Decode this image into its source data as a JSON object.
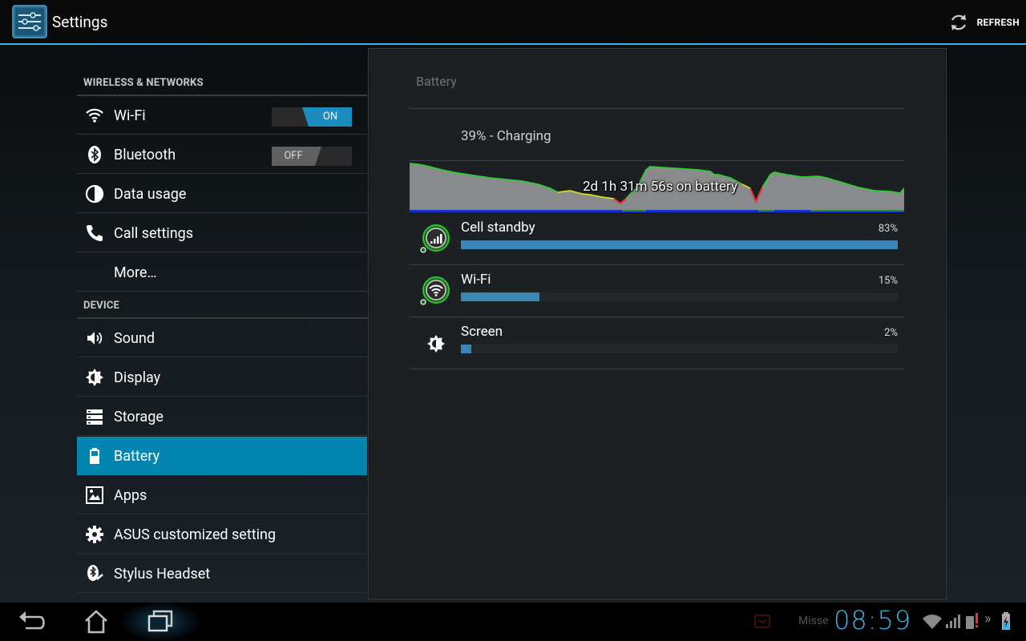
{
  "action_bar": {
    "title": "Settings",
    "refresh_label": "REFRESH"
  },
  "sidebar": {
    "sections": [
      {
        "header": "WIRELESS & NETWORKS"
      },
      {
        "header": "DEVICE"
      }
    ],
    "items": [
      {
        "label": "Wi-Fi",
        "icon": "wifi-icon",
        "toggle": "ON"
      },
      {
        "label": "Bluetooth",
        "icon": "bluetooth-icon",
        "toggle": "OFF"
      },
      {
        "label": "Data usage",
        "icon": "data-usage-icon"
      },
      {
        "label": "Call settings",
        "icon": "phone-icon"
      },
      {
        "label": "More…"
      },
      {
        "label": "Sound",
        "icon": "speaker-icon"
      },
      {
        "label": "Display",
        "icon": "brightness-icon"
      },
      {
        "label": "Storage",
        "icon": "storage-icon"
      },
      {
        "label": "Battery",
        "icon": "battery-icon",
        "selected": true
      },
      {
        "label": "Apps",
        "icon": "apps-icon"
      },
      {
        "label": "ASUS customized setting",
        "icon": "gear-icon"
      },
      {
        "label": "Stylus Headset",
        "icon": "stylus-headset-icon"
      }
    ]
  },
  "battery": {
    "title": "Battery",
    "status": "39% - Charging",
    "history_label": "2d 1h 31m 56s on battery",
    "usage": [
      {
        "name": "Cell standby",
        "percent_label": "83%",
        "percent": 83,
        "icon": "cell-signal-icon"
      },
      {
        "name": "Wi-Fi",
        "percent_label": "15%",
        "percent": 15,
        "icon": "wifi-icon"
      },
      {
        "name": "Screen",
        "percent_label": "2%",
        "percent": 2,
        "icon": "brightness-icon"
      }
    ]
  },
  "status_bar": {
    "notification_text": "Misse",
    "clock": "08:59"
  },
  "colors": {
    "accent": "#33b5e5",
    "selected_item": "#0385b1",
    "usage_bar": "#3a86b6",
    "graph_line": "#33cc33"
  }
}
